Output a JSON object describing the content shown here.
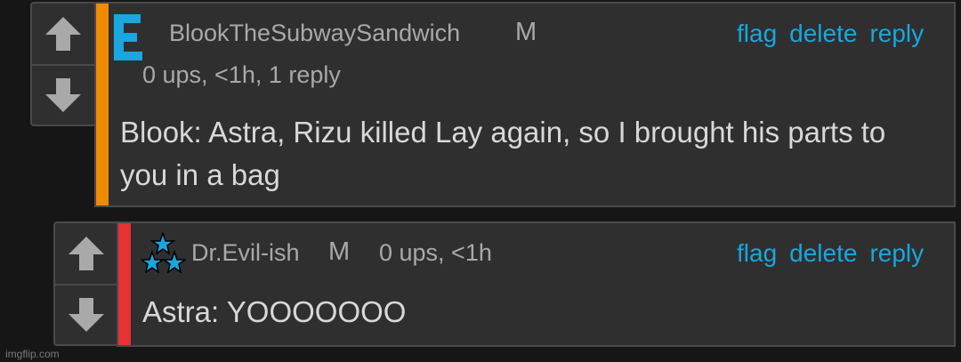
{
  "colors": {
    "background": "#161616",
    "panel": "#2f2f2f",
    "border": "#4a4a4a",
    "arrow": "#a9a9a9",
    "link": "#1aa6de",
    "comment1_stripe": "#f08a00",
    "comment2_stripe": "#e63232",
    "avatar_e": "#1aa6de"
  },
  "comments": [
    {
      "username": "BlookTheSubwaySandwich",
      "badge": "M",
      "meta": "0 ups, <1h, 1 reply",
      "avatar_icon": "letter-e-icon",
      "avatar_letter": "E",
      "actions": {
        "flag": "flag",
        "delete": "delete",
        "reply": "reply"
      },
      "text": "Blook: Astra, Rizu killed Lay again, so I brought his parts to you in a bag"
    },
    {
      "username": "Dr.Evil-ish",
      "badge": "M",
      "meta": "0 ups, <1h",
      "avatar_icon": "three-stars-icon",
      "actions": {
        "flag": "flag",
        "delete": "delete",
        "reply": "reply"
      },
      "text": "Astra: YOOOOOOO"
    }
  ],
  "watermark": "imgflip.com"
}
